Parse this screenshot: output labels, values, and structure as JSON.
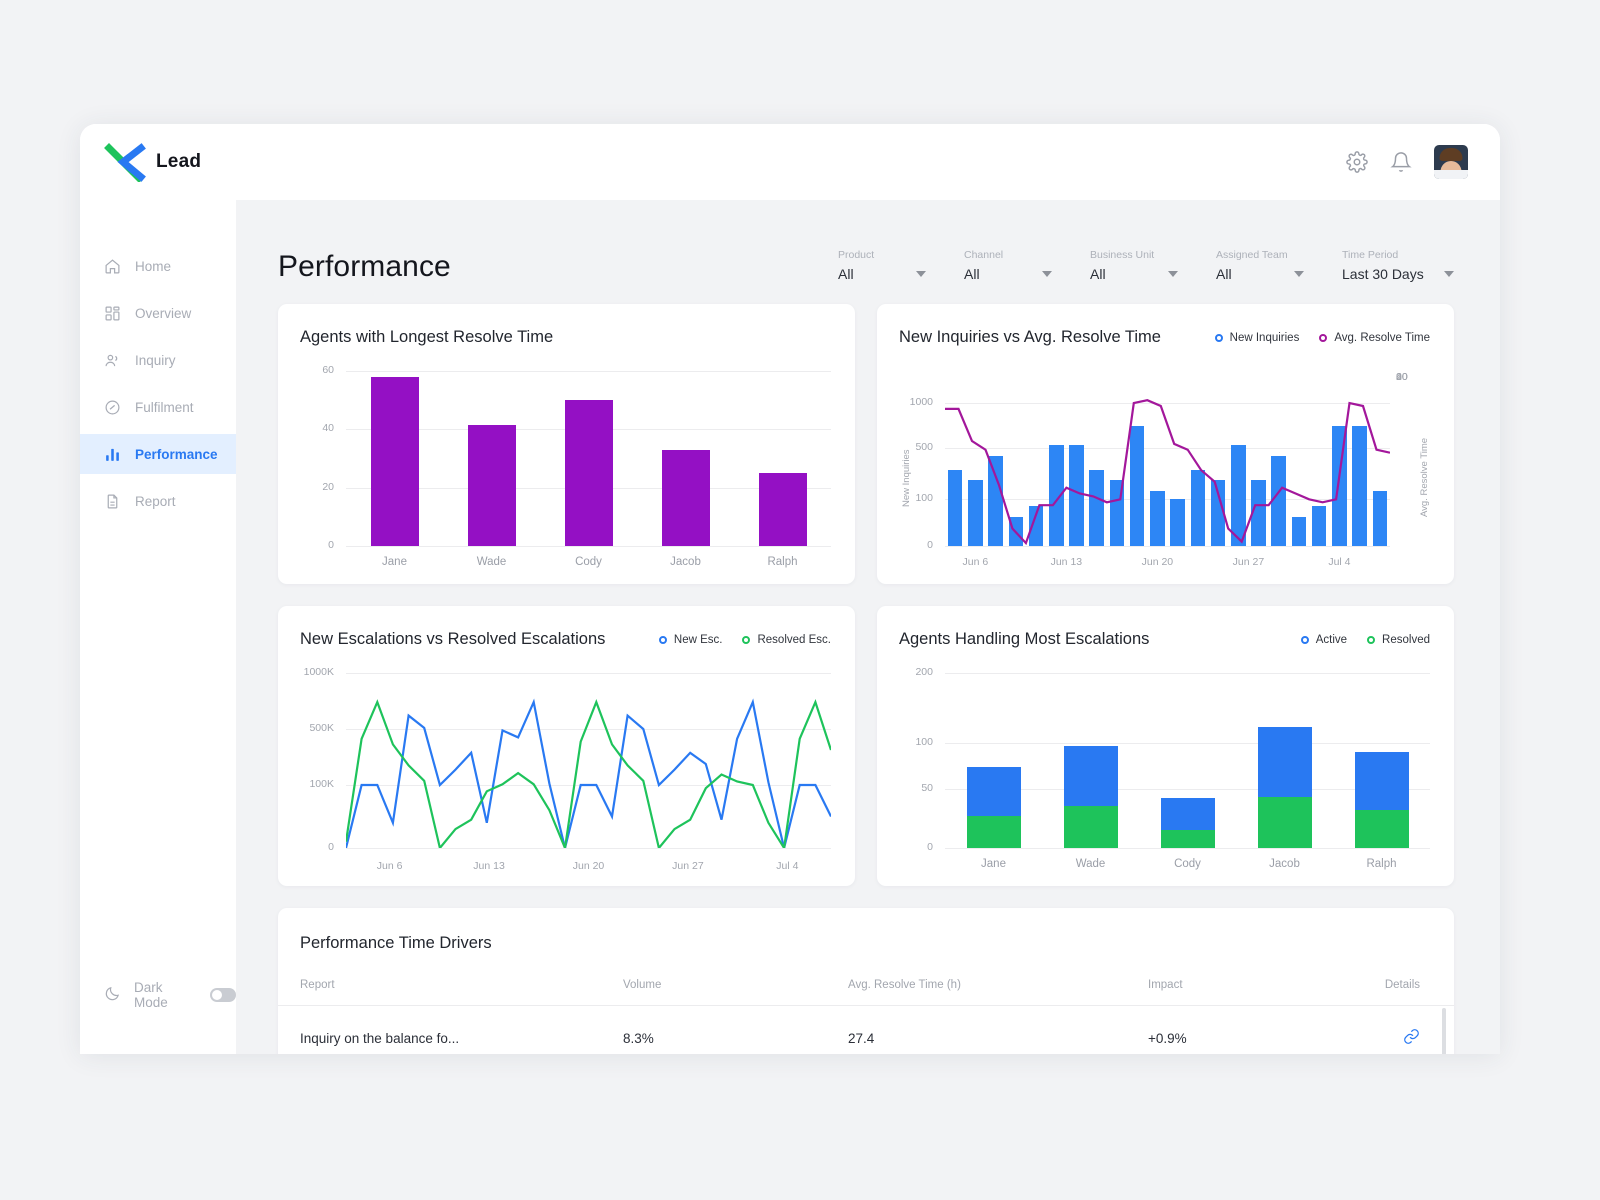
{
  "brand": {
    "name": "Lead",
    "logo_icon": "x-logo"
  },
  "header": {
    "settings_icon": "gear-icon",
    "notifications_icon": "bell-icon",
    "avatar": "user-avatar"
  },
  "sidebar": {
    "items": [
      {
        "label": "Home",
        "icon": "home-icon",
        "active": false
      },
      {
        "label": "Overview",
        "icon": "grid-icon",
        "active": false
      },
      {
        "label": "Inquiry",
        "icon": "people-icon",
        "active": false
      },
      {
        "label": "Fulfilment",
        "icon": "gauge-icon",
        "active": false
      },
      {
        "label": "Performance",
        "icon": "bar-chart-icon",
        "active": true
      },
      {
        "label": "Report",
        "icon": "document-icon",
        "active": false
      }
    ],
    "dark_mode": {
      "label": "Dark Mode",
      "icon": "moon-icon",
      "enabled": false
    }
  },
  "page": {
    "title": "Performance"
  },
  "filters": [
    {
      "label": "Product",
      "value": "All"
    },
    {
      "label": "Channel",
      "value": "All"
    },
    {
      "label": "Business Unit",
      "value": "All"
    },
    {
      "label": "Assigned Team",
      "value": "All"
    },
    {
      "label": "Time Period",
      "value": "Last 30 Days"
    }
  ],
  "colors": {
    "accent_blue": "#2979f2",
    "bar_purple": "#9410c4",
    "line_purple": "#a3179b",
    "bar_blue": "#2d86f5",
    "green": "#1ec35b",
    "sidebar_active_bg": "#e3efff",
    "page_bg": "#f2f3f5"
  },
  "chart_data": [
    {
      "id": "agents-longest-resolve-time",
      "type": "bar",
      "title": "Agents with Longest Resolve Time",
      "categories": [
        "Jane",
        "Wade",
        "Cody",
        "Jacob",
        "Ralph"
      ],
      "values": [
        58,
        41.5,
        50,
        33,
        25
      ],
      "xlabel": "",
      "ylabel": "",
      "yticks": [
        0,
        20,
        40,
        60
      ],
      "ylim": [
        0,
        60
      ],
      "grid": true,
      "legend": null,
      "series_color": "#9410c4"
    },
    {
      "id": "new-inquiries-vs-avg-resolve-time",
      "type": "bar+line",
      "title": "New Inquiries vs Avg. Resolve Time",
      "legend": [
        {
          "name": "New Inquiries",
          "color": "#2979f2"
        },
        {
          "name": "Avg. Resolve Time",
          "color": "#a3179b"
        }
      ],
      "legend_position": "top-right",
      "x": [
        "Jun 6",
        "Jun 13",
        "Jun 20",
        "Jun 27",
        "Jul 4"
      ],
      "xtick_labels": [
        "Jun 6",
        "Jun 13",
        "Jun 20",
        "Jun 27",
        "Jul 4"
      ],
      "ylabel": "New Inquiries",
      "y2label": "Avg. Resolve Time",
      "yticks": [
        0,
        100,
        500,
        1000
      ],
      "y2ticks": [
        0,
        20,
        40,
        60
      ],
      "ylim": [
        0,
        1000
      ],
      "y2lim": [
        0,
        60
      ],
      "grid": true,
      "series": [
        {
          "name": "New Inquiries",
          "type": "bar",
          "color": "#2d86f5",
          "values": [
            330,
            250,
            440,
            62,
            85,
            530,
            530,
            330,
            250,
            740,
            160,
            100,
            330,
            250,
            530,
            250,
            440,
            62,
            85,
            740,
            740,
            160
          ]
        },
        {
          "name": "Avg. Resolve Time",
          "type": "line",
          "color": "#a3179b",
          "values": [
            47,
            47,
            36,
            33,
            21,
            6,
            1,
            14,
            14,
            20,
            18,
            17,
            15,
            16,
            49,
            50,
            48,
            35,
            33,
            26,
            22,
            6,
            1.5,
            14,
            14,
            20,
            18,
            16,
            15,
            16,
            49,
            48,
            33,
            32
          ]
        }
      ]
    },
    {
      "id": "new-escalations-vs-resolved-escalations",
      "type": "line",
      "title": "New Escalations vs Resolved Escalations",
      "legend": [
        {
          "name": "New Esc.",
          "color": "#2979f2"
        },
        {
          "name": "Resolved Esc.",
          "color": "#1ec35b"
        }
      ],
      "legend_position": "top-right",
      "xtick_labels": [
        "Jun 6",
        "Jun 13",
        "Jun 20",
        "Jun 27",
        "Jul 4"
      ],
      "ytick_labels": [
        "0",
        "100K",
        "500K",
        "1000K"
      ],
      "yticks": [
        0,
        100000,
        500000,
        1000000
      ],
      "ylim": [
        0,
        1000000
      ],
      "grid": true,
      "series": [
        {
          "name": "New Esc.",
          "color": "#2979f2",
          "values": [
            0,
            100,
            100,
            40,
            620,
            510,
            100,
            210,
            330,
            40,
            490,
            440,
            740,
            110,
            0,
            100,
            100,
            50,
            620,
            500,
            100,
            210,
            330,
            250,
            45,
            430,
            740,
            120,
            0,
            100,
            100,
            50
          ]
        },
        {
          "name": "Resolved Esc.",
          "color": "#1ec35b",
          "values": [
            10,
            430,
            740,
            390,
            240,
            130,
            0,
            30,
            45,
            90,
            105,
            185,
            105,
            60,
            0,
            410,
            740,
            390,
            240,
            130,
            0,
            30,
            45,
            95,
            175,
            125,
            100,
            40,
            0,
            430,
            740,
            350
          ]
        }
      ]
    },
    {
      "id": "agents-handling-most-escalations",
      "type": "bar",
      "stacked": true,
      "title": "Agents  Handling Most Escalations",
      "legend": [
        {
          "name": "Active",
          "color": "#2979f2"
        },
        {
          "name": "Resolved",
          "color": "#1ec35b"
        }
      ],
      "legend_position": "top-right",
      "categories": [
        "Jane",
        "Wade",
        "Cody",
        "Jacob",
        "Ralph"
      ],
      "yticks": [
        0,
        50,
        100,
        200
      ],
      "ylim": [
        0,
        200
      ],
      "grid": true,
      "series": [
        {
          "name": "Resolved",
          "color": "#1ec35b",
          "values": [
            27,
            35,
            15,
            43,
            32
          ]
        },
        {
          "name": "Active",
          "color": "#2979f2",
          "values": [
            47,
            62,
            27,
            80,
            58
          ]
        }
      ],
      "totals": [
        74,
        97,
        42,
        123,
        90
      ]
    }
  ],
  "table": {
    "title": "Performance Time Drivers",
    "columns": [
      "Report",
      "Volume",
      "Avg. Resolve Time (h)",
      "Impact",
      "Details"
    ],
    "rows": [
      {
        "report": "Inquiry on the balance fo...",
        "volume": "8.3%",
        "avg_resolve_time": "27.4",
        "impact": "+0.9%",
        "details_icon": "link-icon"
      }
    ]
  }
}
